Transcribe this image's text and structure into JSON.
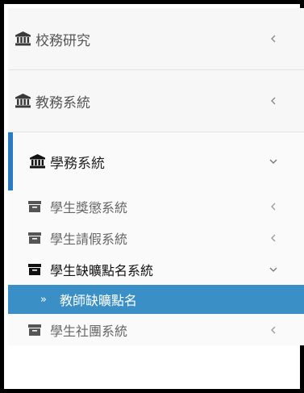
{
  "menu": {
    "items": [
      {
        "label": "校務研究",
        "icon": "bank-icon",
        "chevron": "chevron-left-icon"
      },
      {
        "label": "教務系統",
        "icon": "bank-icon",
        "chevron": "chevron-left-icon"
      },
      {
        "label": "學務系統",
        "icon": "bank-icon",
        "chevron": "chevron-down-icon"
      }
    ],
    "submenu": [
      {
        "label": "學生獎懲系統",
        "icon": "folder-icon",
        "chevron": "chevron-left-icon"
      },
      {
        "label": "學生請假系統",
        "icon": "folder-icon",
        "chevron": "chevron-left-icon"
      },
      {
        "label": "學生缺曠點名系統",
        "icon": "folder-icon",
        "chevron": "chevron-down-icon"
      },
      {
        "label": "學生社團系統",
        "icon": "folder-icon",
        "chevron": "chevron-left-icon"
      }
    ],
    "leaf": {
      "marker": "»",
      "label": "教師缺曠點名"
    }
  },
  "colors": {
    "accent": "#2b7bc4",
    "active_leaf_bg": "#3a8fc6"
  }
}
